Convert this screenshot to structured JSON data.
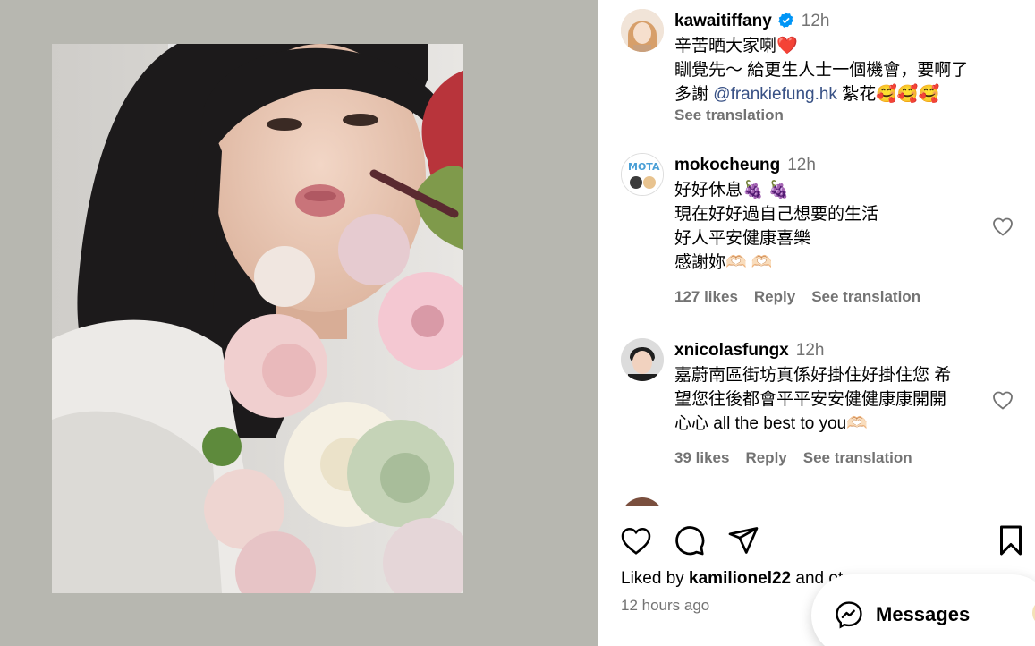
{
  "post": {
    "author": "kawaitiffany",
    "time": "12h",
    "caption_line1": "辛苦晒大家喇❤️",
    "caption_line2": "瞓覺先～ 給更生人士一個機會，要啊了",
    "caption_line3_pre": "多謝 ",
    "caption_mention": "@frankiefung.hk",
    "caption_line3_post": " 紮花🥰🥰🥰",
    "see_translation": "See translation"
  },
  "comments": [
    {
      "user": "mokocheung",
      "time": "12h",
      "lines": [
        "好好休息🍇 🍇",
        "現在好好過自己想要的生活",
        "好人平安健康喜樂",
        "感謝妳🫶🏻 🫶🏻"
      ],
      "likes": "127 likes",
      "reply": "Reply",
      "see_translation": "See translation"
    },
    {
      "user": "xnicolasfungx",
      "time": "12h",
      "lines": [
        "嘉蔚南區街坊真係好掛住好掛住您 希",
        "望您往後都會平平安安健健康康開開",
        "心心 all the best to you🫶🏻"
      ],
      "likes": "39 likes",
      "reply": "Reply",
      "see_translation": "See translation"
    }
  ],
  "actions": {
    "like_icon": "heart-outline-icon",
    "comment_icon": "speech-bubble-icon",
    "share_icon": "paper-plane-icon",
    "save_icon": "bookmark-icon"
  },
  "likes_summary": {
    "prefix": "Liked by ",
    "user": "kamilionel22",
    "suffix": " and ot"
  },
  "posted_ago": "12 hours ago",
  "messages": {
    "label": "Messages",
    "icon": "messenger-icon"
  },
  "colors": {
    "panel_bg": "#b7b7b0",
    "meta_gray": "#737373",
    "mention": "#385185",
    "verified_blue": "#0095f6",
    "like_red": "#ff3040"
  }
}
